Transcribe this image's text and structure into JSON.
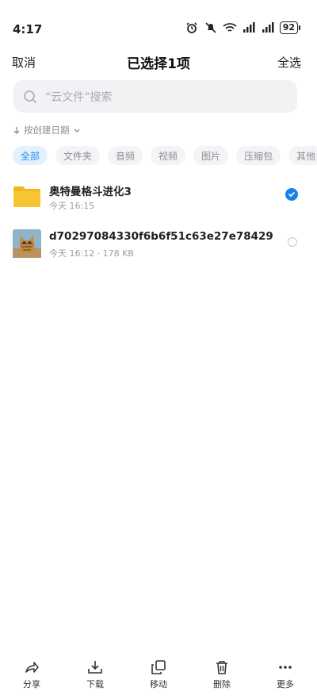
{
  "status": {
    "time": "4:17",
    "battery": "92"
  },
  "header": {
    "cancel": "取消",
    "title": "已选择1项",
    "select_all": "全选"
  },
  "search": {
    "placeholder": "“云文件”搜索"
  },
  "sort": {
    "label": "按创建日期"
  },
  "chips": [
    "全部",
    "文件夹",
    "音频",
    "视频",
    "图片",
    "压缩包",
    "其他"
  ],
  "files": [
    {
      "name": "奥特曼格斗进化3",
      "meta": "今天 16:15",
      "selected": true,
      "kind": "folder"
    },
    {
      "name": "d70297084330f6b6f51c63e27e78429",
      "meta": "今天 16:12 · 178 KB",
      "selected": false,
      "kind": "image"
    }
  ],
  "toolbar": {
    "share": "分享",
    "download": "下载",
    "move": "移动",
    "delete": "删除",
    "more": "更多"
  },
  "colors": {
    "accent": "#1683e8",
    "folder": "#f7c531",
    "chip_active_bg": "#e3f1fd"
  }
}
